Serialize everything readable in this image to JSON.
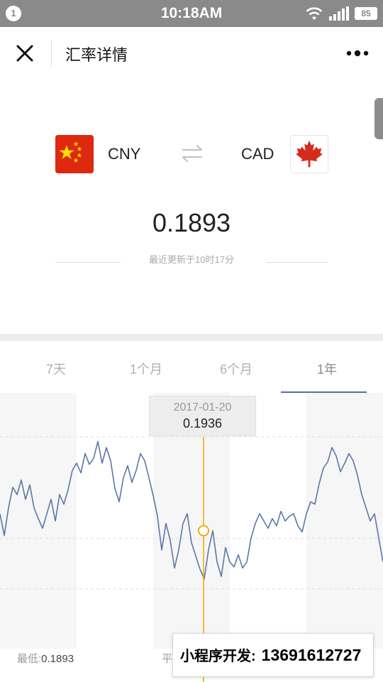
{
  "status_bar": {
    "notification_count": "1",
    "time": "10:18AM",
    "battery": "85",
    "icons": [
      "wifi-icon",
      "signal-icon",
      "battery-icon"
    ]
  },
  "nav": {
    "title": "汇率详情",
    "close_icon": "close-icon",
    "more_icon": "more-icon"
  },
  "pair": {
    "from": {
      "code": "CNY",
      "flag": "china-flag-icon"
    },
    "to": {
      "code": "CAD",
      "flag": "canada-flag-icon"
    },
    "swap_icon": "swap-arrows-icon"
  },
  "rate": {
    "value": "0.1893",
    "updated": "最近更新于10时17分"
  },
  "tabs": [
    {
      "label": "7天",
      "active": false
    },
    {
      "label": "1个月",
      "active": false
    },
    {
      "label": "6个月",
      "active": false
    },
    {
      "label": "1年",
      "active": true
    }
  ],
  "tooltip": {
    "date": "2017-01-20",
    "value": "0.1936"
  },
  "stats": {
    "low_label": "最低:",
    "low_value": "0.1893",
    "avg_label": "平"
  },
  "promo": {
    "label": "小程序开发:",
    "phone": "13691612727"
  },
  "colors": {
    "line": "#5a77a8",
    "cursor": "#f0a400",
    "active_tab_underline": "#5a6f96",
    "china_red": "#de2910",
    "china_star": "#ffde00",
    "canada_red": "#d52b1e"
  },
  "chart_data": {
    "type": "line",
    "title": "",
    "xlabel": "",
    "ylabel": "",
    "period": "1年",
    "selected_date": "2017-01-20",
    "selected_value": 0.1936,
    "y_min_shown": 0.1893,
    "series": [
      {
        "values": [
          0.195,
          0.1932,
          0.1955,
          0.1972,
          0.1966,
          0.1978,
          0.1962,
          0.1974,
          0.1955,
          0.1946,
          0.1938,
          0.195,
          0.1962,
          0.1944,
          0.1966,
          0.1958,
          0.197,
          0.1986,
          0.1992,
          0.1984,
          0.2,
          0.1991,
          0.1996,
          0.201,
          0.1992,
          0.2005,
          0.1994,
          0.1971,
          0.196,
          0.198,
          0.199,
          0.1976,
          0.1986,
          0.2,
          0.1994,
          0.198,
          0.1965,
          0.1948,
          0.192,
          0.1942,
          0.1928,
          0.1905,
          0.192,
          0.1942,
          0.195,
          0.1926,
          0.1915,
          0.1904,
          0.1896,
          0.192,
          0.1936,
          0.191,
          0.1898,
          0.1922,
          0.191,
          0.1906,
          0.1916,
          0.1905,
          0.191,
          0.193,
          0.1942,
          0.195,
          0.1944,
          0.1938,
          0.1946,
          0.194,
          0.1952,
          0.1944,
          0.1948,
          0.195,
          0.194,
          0.1935,
          0.195,
          0.196,
          0.1958,
          0.1975,
          0.1988,
          0.1993,
          0.2005,
          0.1998,
          0.1985,
          0.1992,
          0.2,
          0.1994,
          0.1982,
          0.1966,
          0.1955,
          0.1944,
          0.195,
          0.193,
          0.191
        ]
      }
    ]
  }
}
